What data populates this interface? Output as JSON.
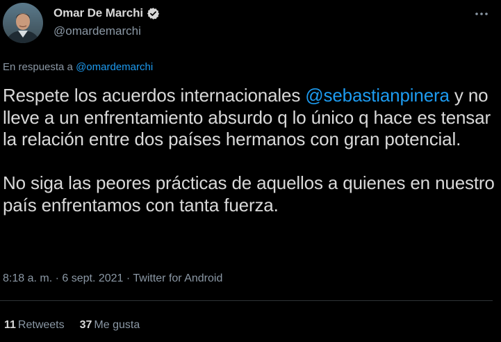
{
  "author": {
    "name": "Omar De Marchi",
    "handle": "@omardemarchi",
    "verified": true,
    "avatar": "avatar-photo"
  },
  "reply": {
    "prefix": "En respuesta a",
    "mention": "@omardemarchi"
  },
  "body": {
    "p1_before": "Respete los acuerdos internacionales ",
    "p1_mention": "@sebastianpinera",
    "p1_after": " y no lleve a un enfrentamiento absurdo q lo único q hace es tensar la relación entre dos países hermanos con gran potencial.",
    "p2": "No siga las peores prácticas de aquellos a quienes en nuestro país enfrentamos con tanta fuerza."
  },
  "meta": {
    "time": "8:18 a. m.",
    "sep1": " · ",
    "date": "6 sept. 2021",
    "sep2": " · ",
    "source": "Twitter for Android"
  },
  "stats": {
    "retweets_count": "11",
    "retweets_label": "Retweets",
    "likes_count": "37",
    "likes_label": "Me gusta"
  },
  "icons": {
    "verified": "verified-badge-icon",
    "more": "more-options-icon"
  },
  "colors": {
    "background": "#000000",
    "text": "#d9d9d9",
    "secondary": "#8b98a5",
    "link": "#1d9bf0",
    "divider": "#2f3336"
  }
}
